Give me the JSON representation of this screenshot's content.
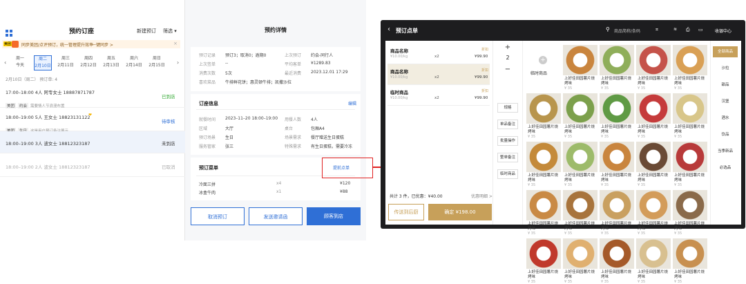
{
  "left": {
    "title": "预约订座",
    "new_button": "新建预订",
    "filter_button": "筛选",
    "promo_badge": "美团",
    "promo_text": "同步美团/点评预订，统一管理提升效率",
    "promo_link": "一键同步 >",
    "days": [
      {
        "week": "周一",
        "date": "今天"
      },
      {
        "week": "周二",
        "date": "2月10日"
      },
      {
        "week": "周三",
        "date": "2月11日"
      },
      {
        "week": "周四",
        "date": "2月12日"
      },
      {
        "week": "周五",
        "date": "2月13日"
      },
      {
        "week": "周六",
        "date": "2月14日"
      },
      {
        "week": "周日",
        "date": "2月15日"
      }
    ],
    "summary": "2月10日（周二）   预订单: 4",
    "reservations": [
      {
        "line": "17:00–18:00  4人  阿专女士 18887871787",
        "tags": [
          "美团",
          "约会"
        ],
        "note": "需要情人节浪漫布置",
        "status": "已到店",
        "status_color": "#2aa52a"
      },
      {
        "line": "18:00–19:00  5人  王女士 18823131122",
        "tags": [
          "美团",
          "生日"
        ],
        "note": "这是用户预订备注展示",
        "status": "待审核",
        "status_color": "#2f6fd6"
      },
      {
        "line": "18:00–19:00  3人  波女士 18812323187",
        "tags": [],
        "note": "",
        "status": "未到店",
        "status_color": "#333333"
      },
      {
        "line": "18:00–19:00  2人  波女士 18812323187",
        "tags": [],
        "note": "",
        "status": "已取消",
        "status_color": "#aaaaaa"
      }
    ]
  },
  "mid": {
    "title": "预约详情",
    "info": {
      "k1": "预订记录",
      "v1": "预订3；取消0；逾期0",
      "k2": "上次预订",
      "v2": "约会-同行人",
      "k3": "上次签单",
      "v3": "--",
      "k4": "平均客单",
      "v4": "¥1289.83",
      "k5": "消费次数",
      "v5": "5次",
      "k6": "最近消费",
      "v6": "2023.12.01 17:29",
      "k7": "喜欢菜品",
      "v7": "牛排鲜花饼；惠灵顿牛排；凯撒沙拉"
    },
    "order_title": "订座信息",
    "edit_label": "编辑",
    "order": {
      "k1": "就餐时间",
      "v1": "2023–11–20 18:00–19:00",
      "k2": "用餐人数",
      "v2": "4人",
      "k3": "区域",
      "v3": "大厅",
      "k4": "桌台",
      "v4": "包厢A4",
      "k5": "预订场景",
      "v5": "生日",
      "k6": "场景需求",
      "v6": "餐厅赠送生日蛋糕",
      "k7": "服务管家",
      "v7": "张三",
      "k8": "特殊需求",
      "v8": "有生日蛋糕，需要冷冻"
    },
    "menu_title": "预订菜单",
    "pre_order_label": "提前点单",
    "menu": [
      {
        "name": "冷面三拼",
        "qty": "x4",
        "price": "¥120"
      },
      {
        "name": "冰盒牛肉",
        "qty": "x1",
        "price": "¥88"
      }
    ],
    "cancel_button": "取消预订",
    "invite_button": "发送邀请函",
    "arrive_button": "顾客到店"
  },
  "pos": {
    "back_title": "预订点单",
    "search_placeholder": "商品简称/条码",
    "cashier_label": "收银中心",
    "items": [
      {
        "name": "商品名称",
        "unit": "¥10.00/kg",
        "qty": "x2",
        "tag": "折扣",
        "price": "¥99.90"
      },
      {
        "name": "商品名称",
        "unit": "¥10.00/kg",
        "qty": "x2",
        "tag": "折扣",
        "price": "¥99.90"
      },
      {
        "name": "临时商品",
        "unit": "¥10.00/kg",
        "qty": "x2",
        "tag": "折扣",
        "price": "¥99.90"
      }
    ],
    "qty_value": "2",
    "functions": [
      "规格",
      "单品备注",
      "批量操作",
      "整单备注",
      "临时商品"
    ],
    "total_text": "共计 3 件，已优惠：¥40.00",
    "discount_detail": "优惠明细 >",
    "send_back_button": "传送到后厨",
    "confirm_button": "确定 ¥198.00",
    "temp_goods_label": "临时商品",
    "products": [
      {
        "name": "上好佳田园薯片烧烤味",
        "price": "¥ 35",
        "color": "#c9853e"
      },
      {
        "name": "上好佳田园薯片烧烤味",
        "price": "¥ 35",
        "color": "#8fae5a"
      },
      {
        "name": "上好佳田园薯片烧烤味",
        "price": "¥ 35",
        "color": "#c5534a"
      },
      {
        "name": "上好佳田园薯片烧烤味",
        "price": "¥ 35",
        "color": "#d9a055"
      },
      {
        "name": "上好佳田园薯片烧烤味",
        "price": "¥ 35",
        "color": "#b8954d"
      },
      {
        "name": "上好佳田园薯片烧烤味",
        "price": "¥ 35",
        "color": "#7ca04c"
      },
      {
        "name": "上好佳田园薯片烧烤味",
        "price": "¥ 35",
        "color": "#5f9a44"
      },
      {
        "name": "上好佳田园薯片烧烤味",
        "price": "¥ 35",
        "color": "#c53b3b"
      },
      {
        "name": "上好佳田园薯片烧烤味",
        "price": "¥ 35",
        "color": "#d8c68a"
      },
      {
        "name": "上好佳田园薯片烧烤味",
        "price": "¥ 35",
        "color": "#c48a3a"
      },
      {
        "name": "上好佳田园薯片烧烤味",
        "price": "¥ 35",
        "color": "#9dbb6a"
      },
      {
        "name": "上好佳田园薯片烧烤味",
        "price": "¥ 35",
        "color": "#c9853e"
      },
      {
        "name": "上好佳田园薯片烧烤味",
        "price": "¥ 35",
        "color": "#6a4a35"
      },
      {
        "name": "上好佳田园薯片烧烤味",
        "price": "¥ 35",
        "color": "#b83a3a"
      },
      {
        "name": "上好佳田园薯片烧烤味",
        "price": "¥ 35",
        "color": "#c98a45"
      },
      {
        "name": "上好佳田园薯片烧烤味",
        "price": "¥ 35",
        "color": "#a8743c"
      },
      {
        "name": "上好佳田园薯片烧烤味",
        "price": "¥ 35",
        "color": "#c9a060"
      },
      {
        "name": "上好佳田园薯片烧烤味",
        "price": "¥ 35",
        "color": "#d39c5a"
      },
      {
        "name": "上好佳田园薯片烧烤味",
        "price": "¥ 35",
        "color": "#8a6a4a"
      },
      {
        "name": "上好佳田园薯片烧烤味",
        "price": "¥ 35",
        "color": "#c0392b"
      },
      {
        "name": "上好佳田园薯片烧烤味",
        "price": "¥ 35",
        "color": "#e0b070"
      },
      {
        "name": "上好佳田园薯片烧烤味",
        "price": "¥ 35",
        "color": "#a55a2a"
      },
      {
        "name": "上好佳田园薯片烧烤味",
        "price": "¥ 35",
        "color": "#d8c090"
      },
      {
        "name": "上好佳田园薯片烧烤味",
        "price": "¥ 35",
        "color": "#c89050"
      }
    ],
    "categories": [
      "全部商品",
      "沙拉",
      "甜品",
      "汉堡",
      "酒水",
      "饮品",
      "当季新品",
      "必选品"
    ]
  }
}
